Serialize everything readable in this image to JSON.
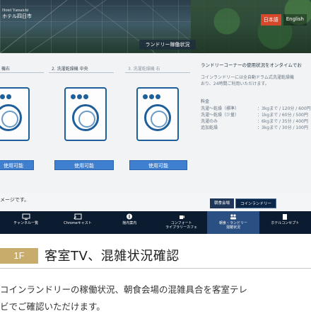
{
  "hotel": {
    "name_en": "Hotel Yamaichi",
    "name_ja": "ホテル四日市"
  },
  "lang": {
    "ja": "日本語",
    "en": "English"
  },
  "panel_title": "ランドリー稼働状況",
  "machines": [
    {
      "label": "機右",
      "status": "使用可能",
      "dim": false
    },
    {
      "label": "2. 洗濯乾燥機 中央",
      "status": "使用可能",
      "dim": false
    },
    {
      "label": "3. 洗濯乾燥機 右",
      "status": "使用可能",
      "dim": true
    }
  ],
  "info": {
    "title": "ランドリーコーナーの使用状況をオンタイムでお",
    "desc1": "コインランドリーには全自動ドラム式洗濯乾燥機",
    "desc2": "おり、24時間ご利用いただけます。",
    "price_label": "料金",
    "prices": [
      {
        "name": "洗濯～乾燥（標準）",
        "detail": "：3kgまで / 120分 / 600円"
      },
      {
        "name": "洗濯～乾燥（少量）",
        "detail": "：1kgまで / 60分 / 500円"
      },
      {
        "name": "洗濯のみ",
        "detail": "：6kgまで / 35分 / 400円"
      },
      {
        "name": "追加乾燥",
        "detail": "：3kgまで / 30分 / 100円"
      }
    ]
  },
  "notice": "メージです。",
  "chips": {
    "breakfast": "朝食会場",
    "laundry": "コインランドリー"
  },
  "nav": [
    {
      "label1": "チャンネル一覧",
      "label2": "",
      "selected": false
    },
    {
      "label1": "Chromeキャスト",
      "label2": "",
      "selected": false
    },
    {
      "label1": "館内案内",
      "label2": "",
      "selected": false
    },
    {
      "label1": "コンフォート",
      "label2": "ライブラリーカフェ",
      "selected": false
    },
    {
      "label1": "朝食・ランドリー",
      "label2": "混雑状況",
      "selected": true
    },
    {
      "label1": "ホテルコンセプト",
      "label2": "",
      "selected": false
    }
  ],
  "section": {
    "floor": "1F",
    "title": "客室TV、混雑状況確認",
    "desc_line1": "コインランドリーの稼働状況、朝食会場の混雑具合を客室テレ",
    "desc_line2": "ビでご確認いただけます。"
  },
  "colors": {
    "accent_gold": "#c8ac6b",
    "tv_nav": "#0b1b30",
    "button_blue": "#3f7fcf",
    "lang_active": "#d7472b"
  }
}
